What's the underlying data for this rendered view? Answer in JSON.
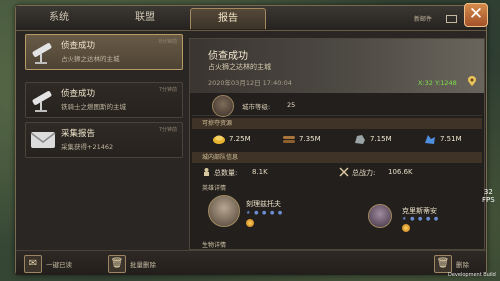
{
  "tabs": [
    {
      "label": "系统",
      "active": false
    },
    {
      "label": "联盟",
      "active": false
    },
    {
      "label": "报告",
      "active": true
    }
  ],
  "header": {
    "new_mail_label": "新邮件",
    "close_glyph": "✕"
  },
  "mail_list": [
    {
      "title": "侦查成功",
      "subtitle": "占火狮之达林的主城",
      "time": "8分钟前",
      "icon": "telescope-icon",
      "selected": true
    },
    {
      "title": "侦查成功",
      "subtitle": "铁骑士之燃图斯的主城",
      "time": "7分钟前",
      "icon": "telescope-icon",
      "selected": false
    },
    {
      "title": "采集报告",
      "subtitle": "采集获得+21462",
      "time": "7分钟前",
      "icon": "envelope-icon",
      "selected": false
    }
  ],
  "report": {
    "title": "侦查成功",
    "subtitle": "占火狮之达林的主城",
    "time": "2020年03月12日 17:40:04",
    "coords": "X:32 Y:1248",
    "city_level_label": "城市等级:",
    "city_level": "25",
    "plunder_label": "可掠夺资源",
    "resources": [
      {
        "icon": "food-icon",
        "value": "7.25M",
        "color": "#e8b530"
      },
      {
        "icon": "wood-icon",
        "value": "7.35M",
        "color": "#a8763c"
      },
      {
        "icon": "stone-icon",
        "value": "7.15M",
        "color": "#9aa3a6"
      },
      {
        "icon": "ore-icon",
        "value": "7.51M",
        "color": "#4f8fe0"
      }
    ],
    "troops_label": "城内部队信息",
    "total_troops_label": "总数量:",
    "total_troops": "8.1K",
    "total_power_label": "总战力:",
    "total_power": "106.6K",
    "heroes_label": "英雄详情",
    "heroes": [
      {
        "name": "刻理兹托夫"
      },
      {
        "name": "克里斯蒂安"
      }
    ],
    "buildings_label": "生物详情"
  },
  "footer": {
    "read_all_label": "一键已读",
    "batch_delete_label": "批量删除",
    "delete_label": "删除"
  },
  "overlay": {
    "fps_value": "32",
    "fps_label": "FPS",
    "dev_build": "Development Build"
  }
}
